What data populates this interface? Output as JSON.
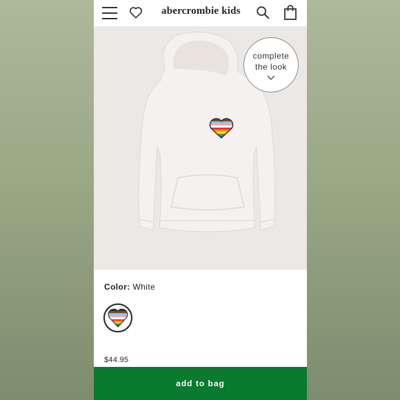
{
  "header": {
    "brand": "abercrombie kids"
  },
  "promo": {
    "complete_line1": "complete",
    "complete_line2": "the look"
  },
  "product": {
    "color_label": "Color:",
    "color_value": "White",
    "price": "$44.95"
  },
  "cta": {
    "add_to_bag": "add to bag"
  },
  "colors": {
    "accent_green": "#0a7a2e",
    "hoodie": "#f4f1ef",
    "background_side": "#9aa885"
  },
  "icons": [
    "menu-icon",
    "heart-icon",
    "search-icon",
    "bag-icon",
    "chevron-down-icon",
    "pride-heart-icon"
  ]
}
